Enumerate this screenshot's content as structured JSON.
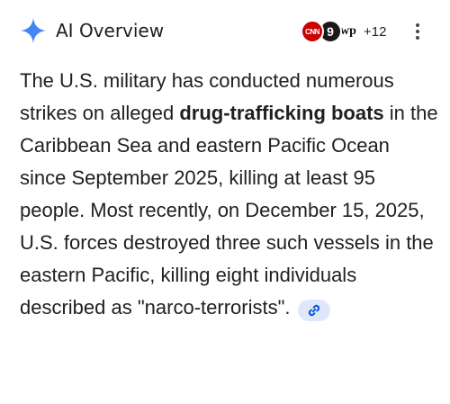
{
  "header": {
    "title": "AI Overview",
    "more_sources": "+12",
    "sources": [
      {
        "name": "CNN",
        "label": "CNN"
      },
      {
        "name": "FOX",
        "label": "9"
      },
      {
        "name": "Washington Post",
        "label": "wp"
      }
    ],
    "menu_icon": "more-vert-icon"
  },
  "overview": {
    "text_before_bold": "The U.S. military has conducted numerous strikes on alleged ",
    "bold_text": "drug-trafficking boats",
    "text_after_bold": " in the Caribbean Sea and eastern Pacific Ocean since September 2025, killing at least 95 people. Most recently, on December 15, 2025, U.S. forces destroyed three such vessels in the eastern Pacific, killing eight individuals described as \"narco-terrorists\".",
    "link_icon": "link-icon"
  },
  "colors": {
    "sparkle_blue": "#4285f4",
    "chip_background": "#dfe8fb",
    "chip_icon": "#0b57d0",
    "cnn_red": "#cc0000"
  }
}
